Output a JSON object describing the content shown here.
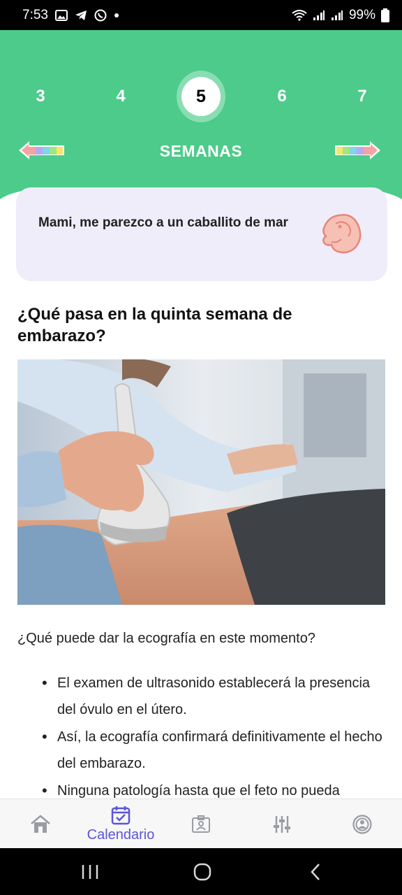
{
  "status_bar": {
    "time": "7:53",
    "battery": "99%",
    "icons": [
      "gallery-icon",
      "telegram-icon",
      "whatsapp-icon",
      "dot-icon",
      "wifi-icon",
      "signal-icon",
      "signal-icon",
      "battery-icon"
    ]
  },
  "header": {
    "weeks": [
      "3",
      "4",
      "5",
      "6",
      "7"
    ],
    "active_week": "5",
    "title": "SEMANAS",
    "prev_icon": "rainbow-arrow-left-icon",
    "next_icon": "rainbow-arrow-right-icon"
  },
  "message_card": {
    "text": "Mami, me parezco a un caballito de mar",
    "icon": "embryo-icon"
  },
  "content": {
    "title": "¿Qué pasa en la quinta semana de embarazo?",
    "image_alt_icon": "ultrasound-photo",
    "question": "¿Qué puede dar la ecografía en este momento?",
    "bullets": [
      " El examen de ultrasonido establecerá la presencia del óvulo en el útero.",
      " Así, la ecografía confirmará definitivamente el hecho del embarazo.",
      " Ninguna patología hasta que el feto no pueda"
    ]
  },
  "bottom_nav": {
    "items": [
      {
        "icon": "home-icon",
        "label": ""
      },
      {
        "icon": "calendar-check-icon",
        "label": "Calendario"
      },
      {
        "icon": "id-badge-icon",
        "label": ""
      },
      {
        "icon": "sliders-icon",
        "label": ""
      },
      {
        "icon": "profile-icon",
        "label": ""
      }
    ]
  },
  "colors": {
    "primary_green": "#4ccb8a",
    "accent_purple": "#5b54d6",
    "card_bg": "#efedfa"
  }
}
